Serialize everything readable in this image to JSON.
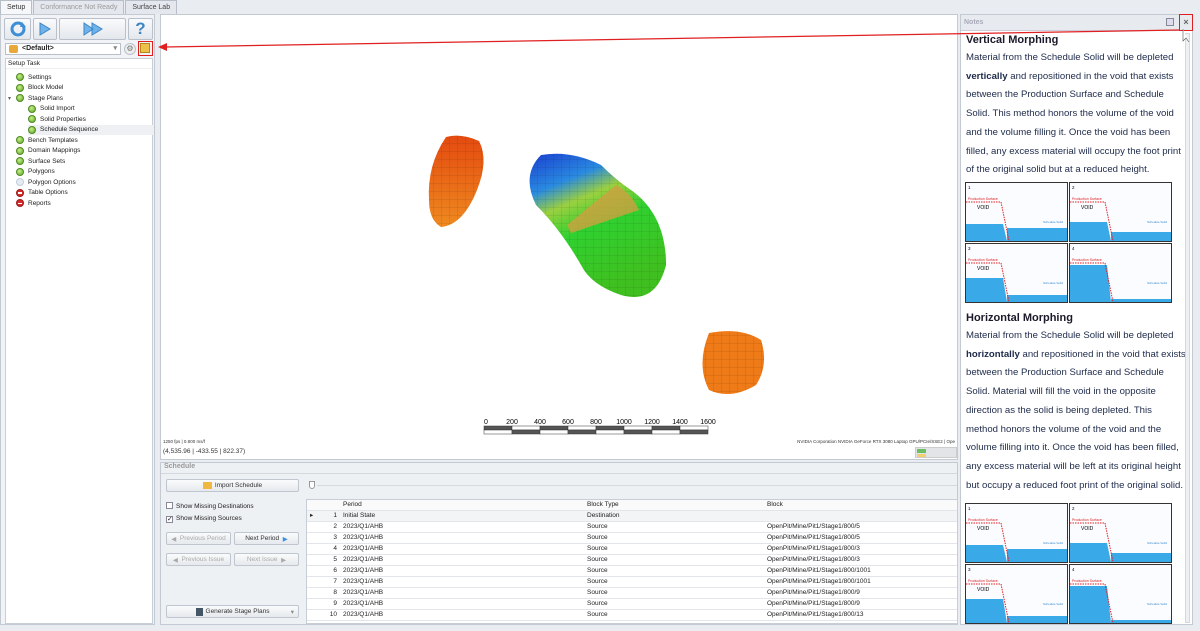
{
  "tabs": [
    {
      "label": "Setup",
      "active": true
    },
    {
      "label": "Conformance Not Ready"
    },
    {
      "label": "Surface Lab"
    }
  ],
  "toolbar": {
    "refresh_icon": "refresh-icon",
    "run_icon": "play-icon",
    "run_all_icon": "fast-forward-icon",
    "help_icon": "help-icon"
  },
  "profile": {
    "value": "<Default>",
    "settings_icon": "gear-icon",
    "notes_icon": "notes-icon"
  },
  "tree": {
    "header": "Setup Task",
    "items": [
      {
        "label": "Settings",
        "status": "ok",
        "level": 0
      },
      {
        "label": "Block Model",
        "status": "ok",
        "level": 0
      },
      {
        "label": "Stage Plans",
        "status": "ok",
        "level": 0,
        "expanded": true
      },
      {
        "label": "Solid Import",
        "status": "ok",
        "level": 1
      },
      {
        "label": "Solid Properties",
        "status": "ok",
        "level": 1
      },
      {
        "label": "Schedule Sequence",
        "status": "ok",
        "level": 1,
        "selected": true
      },
      {
        "label": "Bench Templates",
        "status": "ok",
        "level": 0
      },
      {
        "label": "Domain Mappings",
        "status": "ok",
        "level": 0
      },
      {
        "label": "Surface Sets",
        "status": "ok",
        "level": 0
      },
      {
        "label": "Polygons",
        "status": "ok",
        "level": 0
      },
      {
        "label": "Polygon Options",
        "status": "empty",
        "level": 0
      },
      {
        "label": "Table Options",
        "status": "error",
        "level": 0
      },
      {
        "label": "Reports",
        "status": "error",
        "level": 0
      }
    ]
  },
  "viewport": {
    "scale_ticks": [
      "0",
      "200",
      "400",
      "600",
      "800",
      "1000",
      "1200",
      "1400",
      "1600"
    ],
    "fps": "1250 fps | 0.800 ms/f",
    "coords": "(4,535.96 | -433.55 | 822.37)",
    "gpu": "NVIDIA Corporation NVIDIA GeForce RTX 3080 Laptop GPU/PCIe/SSE2 | Ope"
  },
  "schedule": {
    "title": "Schedule",
    "import_label": "Import Schedule",
    "show_missing_destinations": {
      "label": "Show Missing Destinations",
      "checked": false
    },
    "show_missing_sources": {
      "label": "Show Missing Sources",
      "checked": true
    },
    "previous_period": "Previous Period",
    "next_period": "Next Period",
    "previous_issue": "Previous Issue",
    "next_issue": "Next Issue",
    "generate_label": "Generate Stage Plans",
    "columns": [
      "Period",
      "Block Type",
      "Block"
    ],
    "rows": [
      [
        "1",
        "Initial State",
        "Destination",
        ""
      ],
      [
        "2",
        "2023/Q1/AHB",
        "Source",
        "OpenPit/Mine/Pit1/Stage1/800/5"
      ],
      [
        "3",
        "2023/Q1/AHB",
        "Source",
        "OpenPit/Mine/Pit1/Stage1/800/5"
      ],
      [
        "4",
        "2023/Q1/AHB",
        "Source",
        "OpenPit/Mine/Pit1/Stage1/800/3"
      ],
      [
        "5",
        "2023/Q1/AHB",
        "Source",
        "OpenPit/Mine/Pit1/Stage1/800/3"
      ],
      [
        "6",
        "2023/Q1/AHB",
        "Source",
        "OpenPit/Mine/Pit1/Stage1/800/1001"
      ],
      [
        "7",
        "2023/Q1/AHB",
        "Source",
        "OpenPit/Mine/Pit1/Stage1/800/1001"
      ],
      [
        "8",
        "2023/Q1/AHB",
        "Source",
        "OpenPit/Mine/Pit1/Stage1/800/9"
      ],
      [
        "9",
        "2023/Q1/AHB",
        "Source",
        "OpenPit/Mine/Pit1/Stage1/800/9"
      ],
      [
        "10",
        "2023/Q1/AHB",
        "Source",
        "OpenPit/Mine/Pit1/Stage1/800/13"
      ]
    ]
  },
  "notes": {
    "title": "Notes",
    "vertical": {
      "heading": "Vertical Morphing",
      "pre": "Material from the Schedule Solid will be depleted ",
      "bold": "vertically",
      "post": " and repositioned in the void that exists between the Production Surface and Schedule Solid. This method honors the volume of the void and the volume filling it. Once the void has been filled, any excess material will occupy the foot print of the original solid but at a reduced height."
    },
    "horizontal": {
      "heading": "Horizontal Morphing",
      "pre": "Material from the Schedule Solid will be depleted ",
      "bold": "horizontally",
      "post": " and repositioned in the void that exists between the Production Surface and Schedule Solid. Material will fill the void in the opposite direction as the solid is being depleted. This method honors the volume of the void and the volume filling into it. Once the void has been filled, any excess material will be left at its original height but occupy a reduced foot print of the original solid."
    },
    "diagram": {
      "production_surface": "Production Surface",
      "void": "VOID",
      "schedule_solid": "Schedule Solid",
      "panels": [
        "1",
        "2",
        "3",
        "4"
      ]
    }
  },
  "colors": {
    "accent_red": "#e02020",
    "water_blue": "#3aa9e8"
  }
}
